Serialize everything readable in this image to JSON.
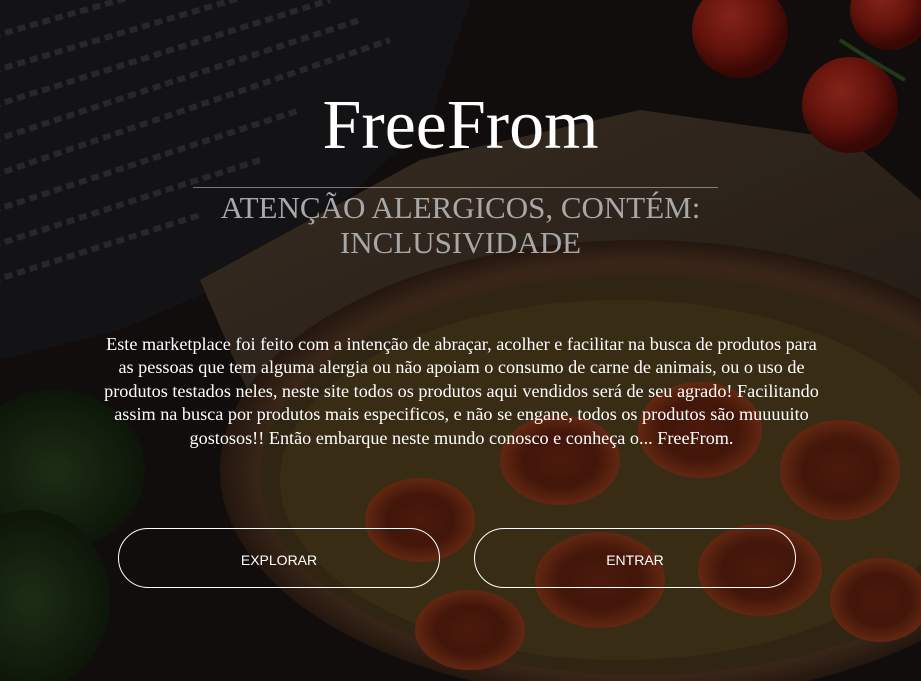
{
  "hero": {
    "title": "FreeFrom",
    "subtitle": "ATENÇÃO ALERGICOS, CONTÉM: INCLUSIVIDADE",
    "description": "Este marketplace foi feito com a intenção de abraçar, acolher e facilitar na busca de produtos para as pessoas que tem alguma alergia ou não apoiam o consumo de carne de animais, ou o uso de produtos testados neles, neste site todos os produtos aqui vendidos será de seu agrado! Facilitando assim na busca por produtos mais especificos, e não se engane, todos os produtos são muuuuito gostosos!! Então embarque neste mundo conosco e conheça o... FreeFrom."
  },
  "actions": {
    "explore_label": "EXPLORAR",
    "enter_label": "ENTRAR"
  },
  "background": {
    "description_icon": "food-photo-background",
    "colors": {
      "text": "#ffffff",
      "subtitle": "#a8a8a8",
      "button_border": "#ffffff"
    }
  }
}
